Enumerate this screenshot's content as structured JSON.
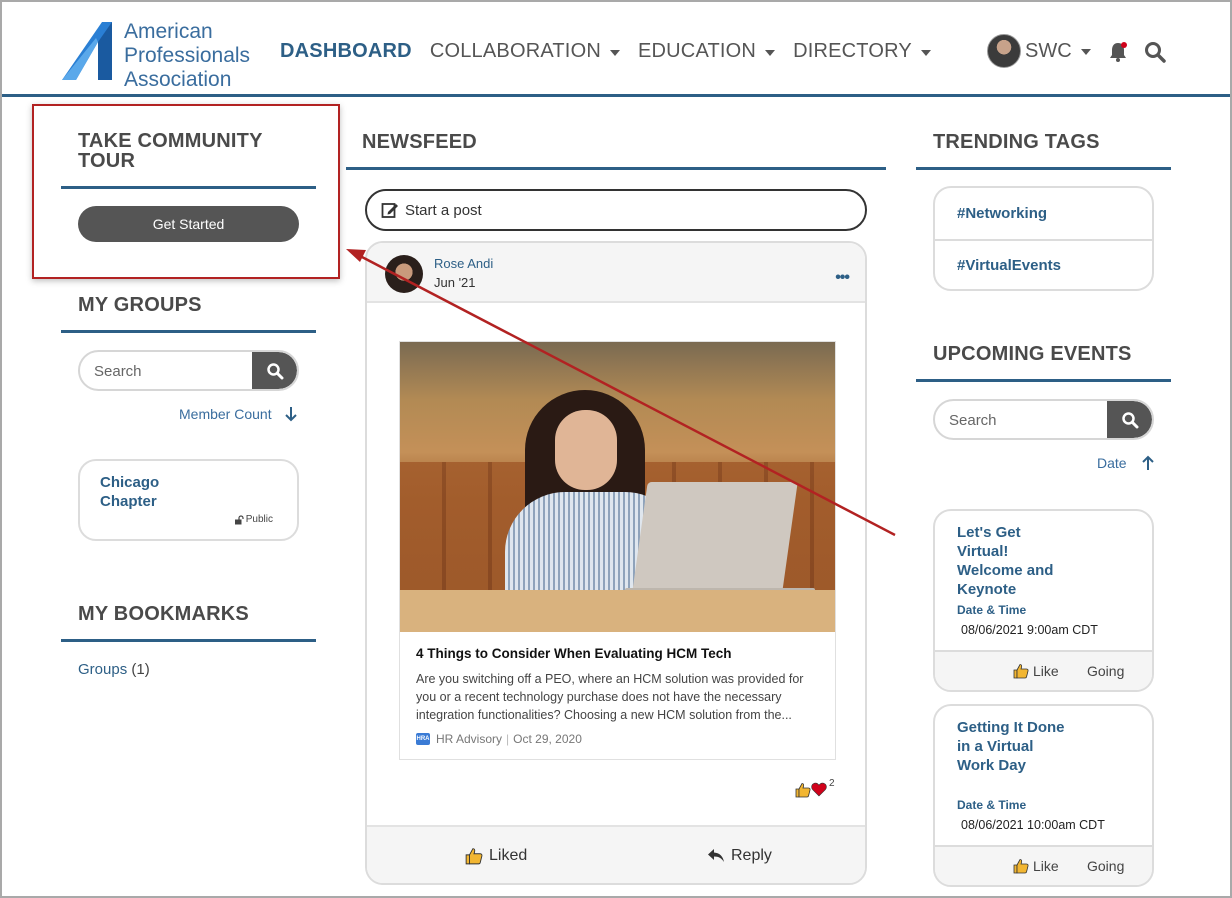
{
  "brand": {
    "logo_lines": [
      "American",
      "Professionals",
      "Association"
    ],
    "accent_color": "#2d5f86",
    "annotation_color": "#b22222"
  },
  "nav": {
    "items": [
      {
        "label": "DASHBOARD",
        "active": true,
        "has_dropdown": false
      },
      {
        "label": "COLLABORATION",
        "active": false,
        "has_dropdown": true
      },
      {
        "label": "EDUCATION",
        "active": false,
        "has_dropdown": true
      },
      {
        "label": "DIRECTORY",
        "active": false,
        "has_dropdown": true
      }
    ],
    "user_initials": "SWC"
  },
  "left": {
    "tour": {
      "title": "TAKE COMMUNITY TOUR",
      "button_label": "Get Started"
    },
    "groups": {
      "title": "MY GROUPS",
      "search_placeholder": "Search",
      "sort_label": "Member Count",
      "items": [
        {
          "name": "Chicago Chapter",
          "visibility": "Public"
        }
      ]
    },
    "bookmarks": {
      "title": "MY BOOKMARKS",
      "items": [
        {
          "label": "Groups",
          "count": "(1)"
        }
      ]
    }
  },
  "newsfeed": {
    "title": "NEWSFEED",
    "start_post_label": "Start a post",
    "post": {
      "author": "Rose Andi",
      "date": "Jun '21",
      "more_label": "•••",
      "article": {
        "title": "4 Things to Consider When Evaluating HCM Tech",
        "body": "Are you switching off a PEO, where an HCM solution was provided for you or a recent technology purchase does not have the necessary integration functionalities? Choosing a new HCM solution from the...",
        "source_logo": "HRA",
        "source": "HR Advisory",
        "source_sep": "|",
        "source_date": "Oct 29, 2020"
      },
      "reaction_count": "2",
      "liked_label": "Liked",
      "reply_label": "Reply"
    }
  },
  "right": {
    "trending": {
      "title": "TRENDING TAGS",
      "tags": [
        "#Networking",
        "#VirtualEvents"
      ]
    },
    "events": {
      "title": "UPCOMING EVENTS",
      "search_placeholder": "Search",
      "sort_label": "Date",
      "items": [
        {
          "title": "Let's Get Virtual! Welcome and Keynote",
          "date_label": "Date & Time",
          "date_value": "08/06/2021 9:00am CDT",
          "like_label": "Like",
          "going_label": "Going"
        },
        {
          "title": "Getting It Done in a Virtual Work Day",
          "date_label": "Date & Time",
          "date_value": "08/06/2021 10:00am CDT",
          "like_label": "Like",
          "going_label": "Going"
        }
      ]
    }
  }
}
